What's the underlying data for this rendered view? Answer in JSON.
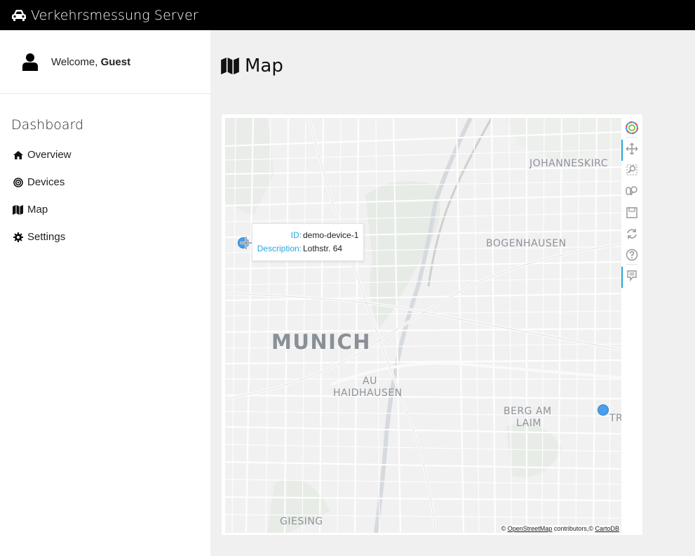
{
  "navbar": {
    "brand": "Verkehrsmessung Server",
    "icon": "car-icon"
  },
  "sidebar": {
    "welcome_prefix": "Welcome,",
    "user_name": "Guest",
    "section_title": "Dashboard",
    "items": [
      {
        "label": "Overview",
        "icon": "home-icon"
      },
      {
        "label": "Devices",
        "icon": "bullseye-icon"
      },
      {
        "label": "Map",
        "icon": "map-icon"
      },
      {
        "label": "Settings",
        "icon": "gear-icon"
      }
    ]
  },
  "main": {
    "title": "Map"
  },
  "map": {
    "districts": {
      "johanneskirchen": "JOHANNESKIRC",
      "bogenhausen": "BOGENHAUSEN",
      "munich": "MUNICH",
      "au": "AU",
      "haidhausen": "HAIDHAUSEN",
      "berg_am_laim_1": "BERG AM",
      "berg_am_laim_2": "LAIM",
      "giesing": "GIESING",
      "truderin": "TR"
    },
    "tooltip": {
      "id_label": "ID:",
      "id_value": "demo-device-1",
      "desc_label": "Description:",
      "desc_value": "Lothstr. 64"
    },
    "attribution": {
      "prefix": "©",
      "osm": "OpenStreetMap",
      "middle": "contributors,©",
      "carto": "CartoDB"
    },
    "marker_color": "#4a9eea",
    "toolbar": [
      "bokeh-logo-icon",
      "pan-icon",
      "box-zoom-icon",
      "wheel-zoom-icon",
      "save-icon",
      "reset-icon",
      "help-icon",
      "hover-icon"
    ]
  },
  "colors": {
    "navbar_bg": "#000000",
    "accent": "#26a7df",
    "main_bg": "#f0f0f0"
  }
}
